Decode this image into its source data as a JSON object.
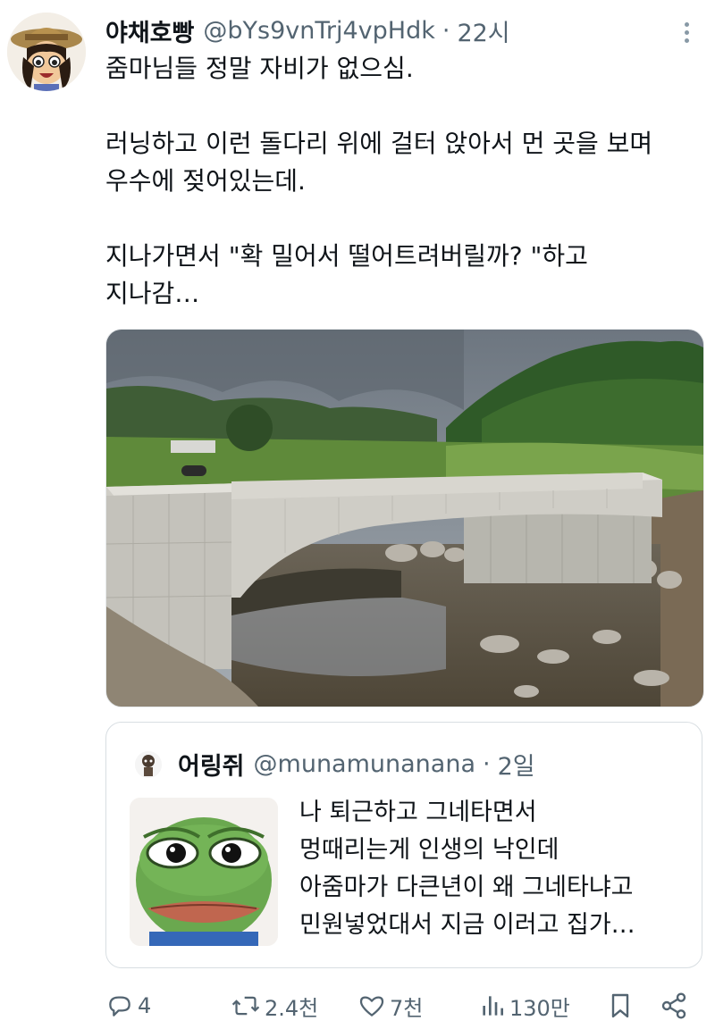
{
  "tweet": {
    "author_name": "야채호빵",
    "author_handle": "@bYs9vnTrj4vpHdk",
    "separator": "·",
    "time": "22시",
    "lines": [
      "줌마님들 정말 자비가 없으심.",
      "러닝하고 이런 돌다리 위에 걸터 앉아서 먼 곳을 보며",
      "우수에 젖어있는데.",
      "지나가면서 \"확 밀어서 떨어트려버릴까? \"하고",
      "지나감…"
    ]
  },
  "quoted": {
    "author_name": "어링쥐",
    "author_handle": "@munamunanana",
    "separator": "·",
    "time": "2일",
    "lines": [
      "나 퇴근하고 그네타면서",
      "멍때리는게 인생의 낙인데",
      "아줌마가 다큰년이 왜 그네타냐고",
      "민원넣었대서 지금 이러고 집가…"
    ]
  },
  "actions": {
    "replies": "4",
    "reposts": "2.4천",
    "likes": "7천",
    "views": "130만"
  },
  "icons": {
    "reply": "reply-icon",
    "repost": "repost-icon",
    "like": "heart-icon",
    "views": "views-icon",
    "bookmark": "bookmark-icon",
    "share": "share-icon",
    "more": "more-icon"
  },
  "colors": {
    "text": "#0f1419",
    "secondary": "#536471",
    "border": "#d8dee2"
  }
}
